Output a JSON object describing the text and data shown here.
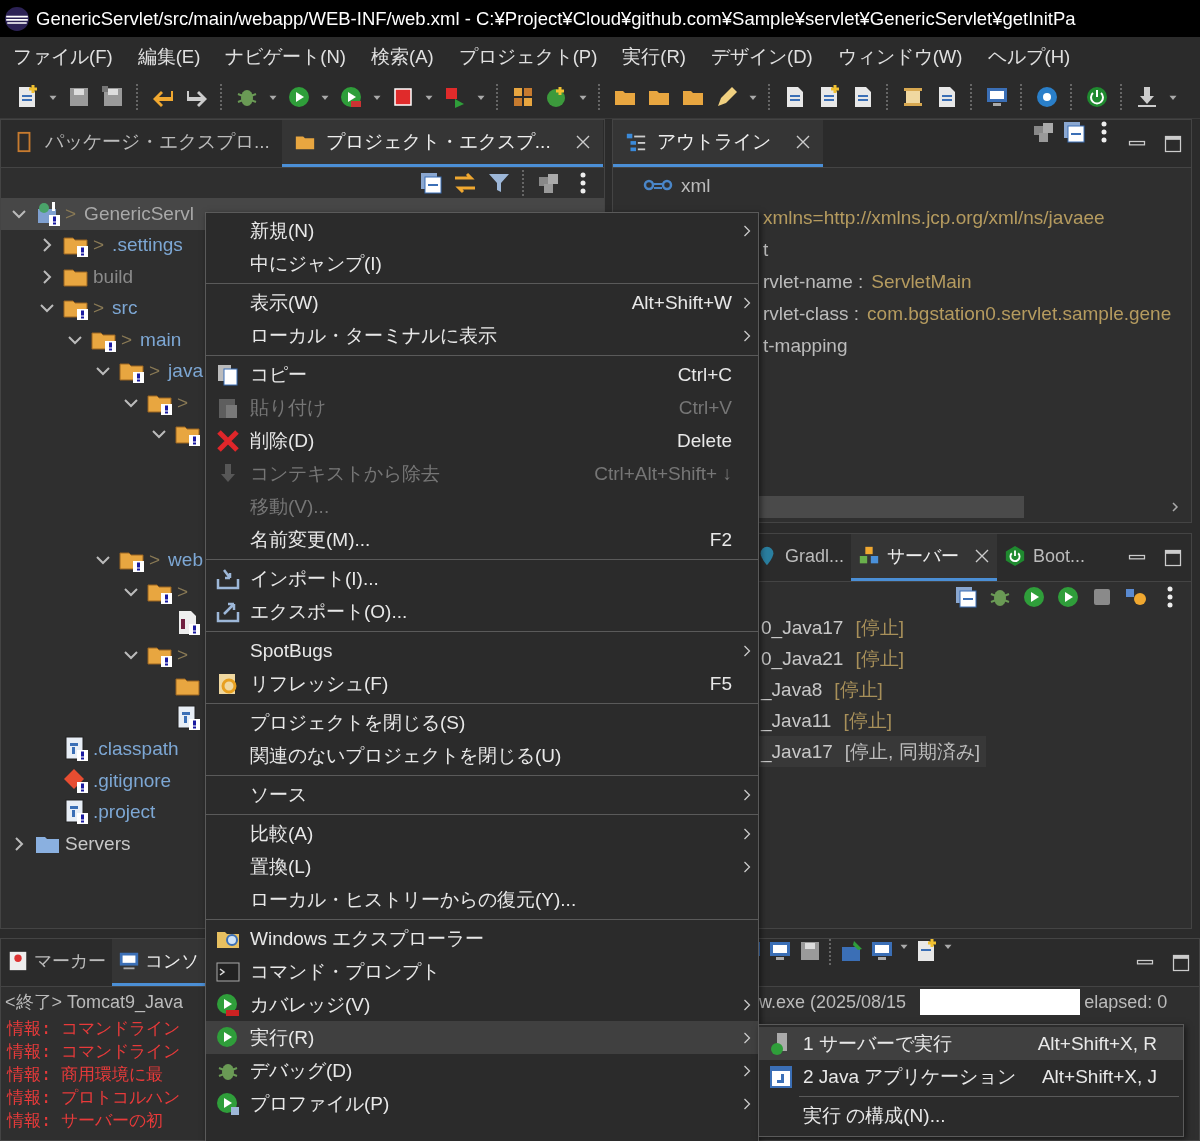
{
  "window": {
    "title": "GenericServlet/src/main/webapp/WEB-INF/web.xml - C:¥Project¥Cloud¥github.com¥Sample¥servlet¥GenericServlet¥getInitPa"
  },
  "menu_bar": [
    "ファイル(F)",
    "編集(E)",
    "ナビゲート(N)",
    "検索(A)",
    "プロジェクト(P)",
    "実行(R)",
    "デザイン(D)",
    "ウィンドウ(W)",
    "ヘルプ(H)"
  ],
  "explorer": {
    "tabs": [
      {
        "label": "パッケージ・エクスプロ...",
        "selected": false,
        "closable": false
      },
      {
        "label": "プロジェクト・エクスプ...",
        "selected": true,
        "closable": true
      }
    ],
    "tree": [
      {
        "kind": "project",
        "label": "GenericServl",
        "marker": ">",
        "selected": true,
        "expanded": true,
        "children": [
          {
            "kind": "folder",
            "label": ".settings",
            "marker": ">",
            "selected": false,
            "expanded": false
          },
          {
            "kind": "ignored-folder",
            "label": "build",
            "selected": false,
            "expanded": false
          },
          {
            "kind": "folder",
            "label": "src",
            "marker": ">",
            "selected": false,
            "expanded": true,
            "children": [
              {
                "kind": "folder",
                "label": "main",
                "marker": ">",
                "selected": false,
                "expanded": true,
                "children": [
                  {
                    "kind": "folder",
                    "label": "java",
                    "marker": ">",
                    "selected": false,
                    "expanded": true,
                    "children": [
                      {
                        "kind": "folder",
                        "marker": ">",
                        "selected": false,
                        "expanded": true,
                        "children": [
                          {
                            "kind": "folder",
                            "selected": false,
                            "expanded": true
                          }
                        ]
                      }
                    ]
                  },
                  {
                    "kind": "folder",
                    "label": "web",
                    "marker": ">",
                    "selected": false,
                    "expanded": true,
                    "children": [
                      {
                        "kind": "folder",
                        "marker": ">",
                        "selected": false,
                        "expanded": true,
                        "children": [
                          {
                            "kind": "json-file",
                            "selected": false
                          }
                        ]
                      },
                      {
                        "kind": "folder",
                        "marker": ">",
                        "selected": false,
                        "expanded": true,
                        "children": [
                          {
                            "kind": "plain-folder",
                            "selected": false
                          },
                          {
                            "kind": "file",
                            "selected": false
                          }
                        ]
                      }
                    ]
                  }
                ]
              }
            ]
          },
          {
            "kind": "file",
            "label": ".classpath",
            "selected": false
          },
          {
            "kind": "git-file",
            "label": ".gitignore",
            "selected": false
          },
          {
            "kind": "file",
            "label": ".project",
            "selected": false
          }
        ]
      },
      {
        "kind": "servers",
        "label": "Servers",
        "selected": false,
        "expanded": false
      }
    ]
  },
  "outline": {
    "tabs": [
      {
        "label": "アウトライン",
        "selected": true,
        "closable": true
      }
    ],
    "rows": [
      {
        "kind": "root",
        "name": "xml"
      },
      {
        "kind": "covered",
        "value": "xmlns=http://xmlns.jcp.org/xml/ns/javaee"
      },
      {
        "kind": "covered",
        "name": "t"
      },
      {
        "kind": "covered",
        "name": "rvlet-name :",
        "value": "ServletMain"
      },
      {
        "kind": "covered",
        "name": "rvlet-class :",
        "value": "com.bgstation0.servlet.sample.gene"
      },
      {
        "kind": "covered",
        "name": "t-mapping"
      }
    ]
  },
  "servers": {
    "tabs": [
      {
        "label": "Gradl...",
        "selected": false,
        "closable": false
      },
      {
        "label": "サーバー",
        "selected": true,
        "closable": true
      },
      {
        "label": "Boot...",
        "selected": false,
        "closable": false
      }
    ],
    "rows": [
      {
        "name": "0_Java17",
        "status": "[停止]",
        "selected": false
      },
      {
        "name": "0_Java21",
        "status": "[停止]",
        "selected": false
      },
      {
        "name": "_Java8",
        "status": "[停止]",
        "selected": false
      },
      {
        "name": "_Java11",
        "status": "[停止]",
        "selected": false
      },
      {
        "name": "_Java17",
        "status": "[停止, 同期済み]",
        "selected": true
      }
    ]
  },
  "console": {
    "tabs": [
      {
        "label": "マーカー",
        "selected": false
      },
      {
        "label": "コンソ",
        "selected": true
      }
    ],
    "status_left": "<終了> Tomcat9_Java",
    "status_right": "w.exe  (2025/08/15",
    "elapsed": "elapsed: 0",
    "lines": [
      "情報: コマンドライン",
      "情報: コマンドライン",
      "情報: 商用環境に最",
      "情報: プロトコルハン",
      "情報: サーバーの初"
    ]
  },
  "context_menu": {
    "items": [
      {
        "kind": "item",
        "label": "新規(N)",
        "submenu": true,
        "disabled": false,
        "selected": false
      },
      {
        "kind": "item",
        "label": "中にジャンプ(I)",
        "submenu": false,
        "disabled": false,
        "selected": false
      },
      {
        "kind": "separator"
      },
      {
        "kind": "item",
        "label": "表示(W)",
        "shortcut": "Alt+Shift+W",
        "submenu": true,
        "disabled": false,
        "selected": false
      },
      {
        "kind": "item",
        "label": "ローカル・ターミナルに表示",
        "submenu": true,
        "disabled": false,
        "selected": false
      },
      {
        "kind": "separator"
      },
      {
        "kind": "item",
        "label": "コピー",
        "shortcut": "Ctrl+C",
        "submenu": false,
        "disabled": false,
        "selected": false
      },
      {
        "kind": "item",
        "label": "貼り付け",
        "shortcut": "Ctrl+V",
        "submenu": false,
        "disabled": true,
        "selected": false
      },
      {
        "kind": "item",
        "label": "削除(D)",
        "shortcut": "Delete",
        "submenu": false,
        "disabled": false,
        "selected": false
      },
      {
        "kind": "item",
        "label": "コンテキストから除去",
        "shortcut": "Ctrl+Alt+Shift+ ↓",
        "submenu": false,
        "disabled": true,
        "selected": false
      },
      {
        "kind": "item",
        "label": "移動(V)...",
        "submenu": false,
        "disabled": true,
        "selected": false
      },
      {
        "kind": "item",
        "label": "名前変更(M)...",
        "shortcut": "F2",
        "submenu": false,
        "disabled": false,
        "selected": false
      },
      {
        "kind": "separator"
      },
      {
        "kind": "item",
        "label": "インポート(I)...",
        "submenu": false,
        "disabled": false,
        "selected": false
      },
      {
        "kind": "item",
        "label": "エクスポート(O)...",
        "submenu": false,
        "disabled": false,
        "selected": false
      },
      {
        "kind": "separator"
      },
      {
        "kind": "item",
        "label": "SpotBugs",
        "submenu": true,
        "disabled": false,
        "selected": false
      },
      {
        "kind": "item",
        "label": "リフレッシュ(F)",
        "shortcut": "F5",
        "submenu": false,
        "disabled": false,
        "selected": false
      },
      {
        "kind": "separator"
      },
      {
        "kind": "item",
        "label": "プロジェクトを閉じる(S)",
        "submenu": false,
        "disabled": false,
        "selected": false
      },
      {
        "kind": "item",
        "label": "関連のないプロジェクトを閉じる(U)",
        "submenu": false,
        "disabled": false,
        "selected": false
      },
      {
        "kind": "separator"
      },
      {
        "kind": "item",
        "label": "ソース",
        "submenu": true,
        "disabled": false,
        "selected": false
      },
      {
        "kind": "separator"
      },
      {
        "kind": "item",
        "label": "比較(A)",
        "submenu": true,
        "disabled": false,
        "selected": false
      },
      {
        "kind": "item",
        "label": "置換(L)",
        "submenu": true,
        "disabled": false,
        "selected": false
      },
      {
        "kind": "item",
        "label": "ローカル・ヒストリーからの復元(Y)...",
        "submenu": false,
        "disabled": false,
        "selected": false
      },
      {
        "kind": "separator"
      },
      {
        "kind": "item",
        "label": "Windows エクスプローラー",
        "submenu": false,
        "disabled": false,
        "selected": false
      },
      {
        "kind": "item",
        "label": "コマンド・プロンプト",
        "submenu": false,
        "disabled": false,
        "selected": false
      },
      {
        "kind": "item",
        "label": "カバレッジ(V)",
        "submenu": true,
        "disabled": false,
        "selected": false
      },
      {
        "kind": "item",
        "label": "実行(R)",
        "submenu": true,
        "disabled": false,
        "selected": true
      },
      {
        "kind": "item",
        "label": "デバッグ(D)",
        "submenu": true,
        "disabled": false,
        "selected": false
      },
      {
        "kind": "item",
        "label": "プロファイル(P)",
        "submenu": true,
        "disabled": false,
        "selected": false
      }
    ]
  },
  "submenu": {
    "items": [
      {
        "kind": "item",
        "label": "1 サーバーで実行",
        "shortcut": "Alt+Shift+X, R",
        "selected": true
      },
      {
        "kind": "item",
        "label": "2 Java アプリケーション",
        "shortcut": "Alt+Shift+X, J",
        "selected": false
      },
      {
        "kind": "separator"
      },
      {
        "kind": "item",
        "label": "実行 の構成(N)...",
        "selected": false
      }
    ]
  }
}
